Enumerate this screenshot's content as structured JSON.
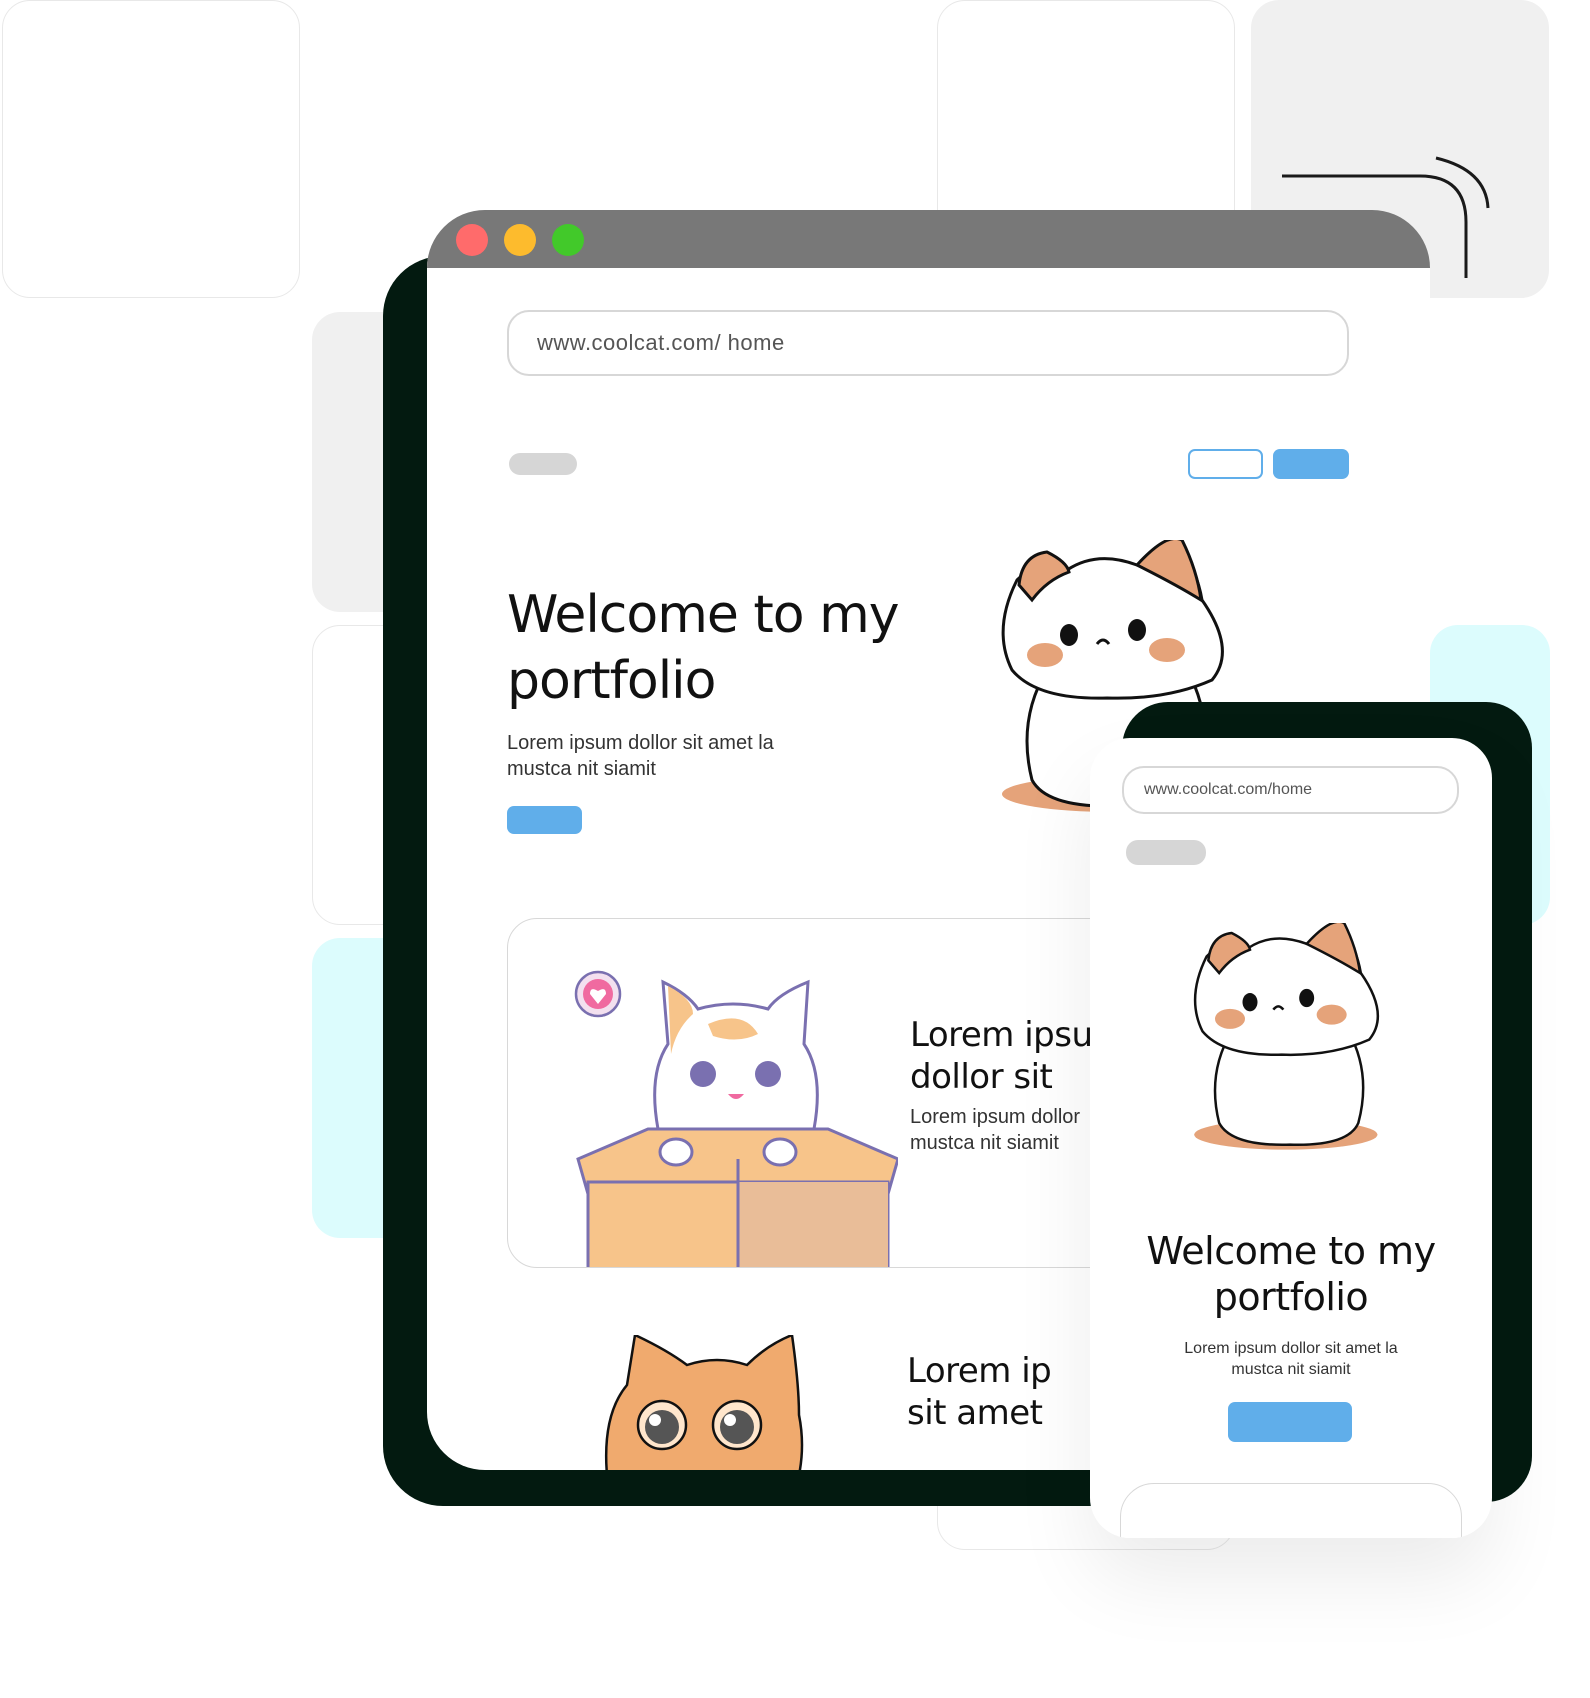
{
  "desktop": {
    "window_controls": {
      "close_color": "#ff6b6b",
      "minimize_color": "#fdbb2d",
      "maximize_color": "#42c92a"
    },
    "url": "www.coolcat.com/ home",
    "hero": {
      "title_line1": "Welcome to my",
      "title_line2": "portfolio",
      "text_line1": "Lorem ipsum dollor sit amet la",
      "text_line2": "mustca nit siamit"
    },
    "card1": {
      "title_line1": "Lorem ipsun",
      "title_line2": "dollor sit",
      "text_line1": "Lorem ipsum dollor",
      "text_line2": "mustca nit siamit"
    },
    "card2": {
      "title_line1": "Lorem ip",
      "title_line2": "sit amet"
    }
  },
  "mobile": {
    "url": "www.coolcat.com/home",
    "hero": {
      "title_line1": "Welcome to my",
      "title_line2": "portfolio",
      "text_line1": "Lorem ipsum dollor sit amet la",
      "text_line2": "mustca nit siamit"
    }
  },
  "colors": {
    "accent": "#60aeea",
    "frame": "#031a10",
    "titlebar": "#787878"
  }
}
